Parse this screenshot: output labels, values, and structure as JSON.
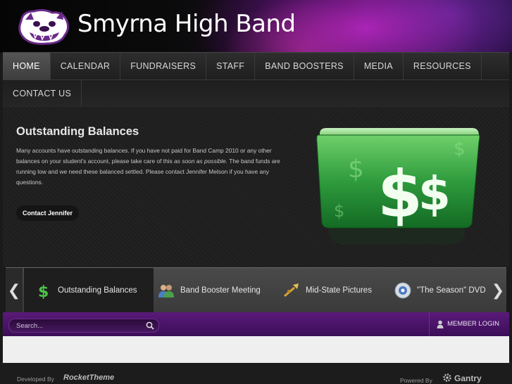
{
  "header": {
    "site_title": "Smyrna High Band",
    "logo_icon": "bulldog-mascot-logo"
  },
  "nav": {
    "items": [
      {
        "label": "HOME",
        "active": true
      },
      {
        "label": "CALENDAR"
      },
      {
        "label": "FUNDRAISERS"
      },
      {
        "label": "STAFF"
      },
      {
        "label": "BAND BOOSTERS"
      },
      {
        "label": "MEDIA"
      },
      {
        "label": "RESOURCES"
      },
      {
        "label": "CONTACT US"
      }
    ]
  },
  "showcase": {
    "title": "Outstanding Balances",
    "body_before": "Many accounts have outstanding balances. If you have not paid for Band Camp 2010 or any other balances on your student's account, please take care of this ",
    "body_em": "as soon as possible.",
    "body_after": " The band funds are running low and we need these balanced settled. Please contact Jennifer Melson if you have any questions.",
    "button_label": "Contact Jennifer",
    "image_icon": "money-folder-icon"
  },
  "tabs": {
    "items": [
      {
        "label": "Outstanding Balances",
        "icon": "dollar-sign-icon",
        "active": true
      },
      {
        "label": "Band Booster Meeting",
        "icon": "people-group-icon"
      },
      {
        "label": "Mid-State Pictures",
        "icon": "trumpet-icon"
      },
      {
        "label": "\"The Season\" DVD",
        "icon": "dvd-disc-icon"
      }
    ],
    "prev_icon": "chevron-left-icon",
    "next_icon": "chevron-right-icon"
  },
  "search": {
    "placeholder": "Search..."
  },
  "member": {
    "label": "MEMBER LOGIN"
  },
  "footer": {
    "developed_by": "Developed By",
    "developer_brand": "RocketTheme",
    "powered_by": "Powered By",
    "framework_brand": "Gantry"
  },
  "colors": {
    "accent_purple": "#5a1a7a",
    "money_green": "#2e9b3c"
  }
}
